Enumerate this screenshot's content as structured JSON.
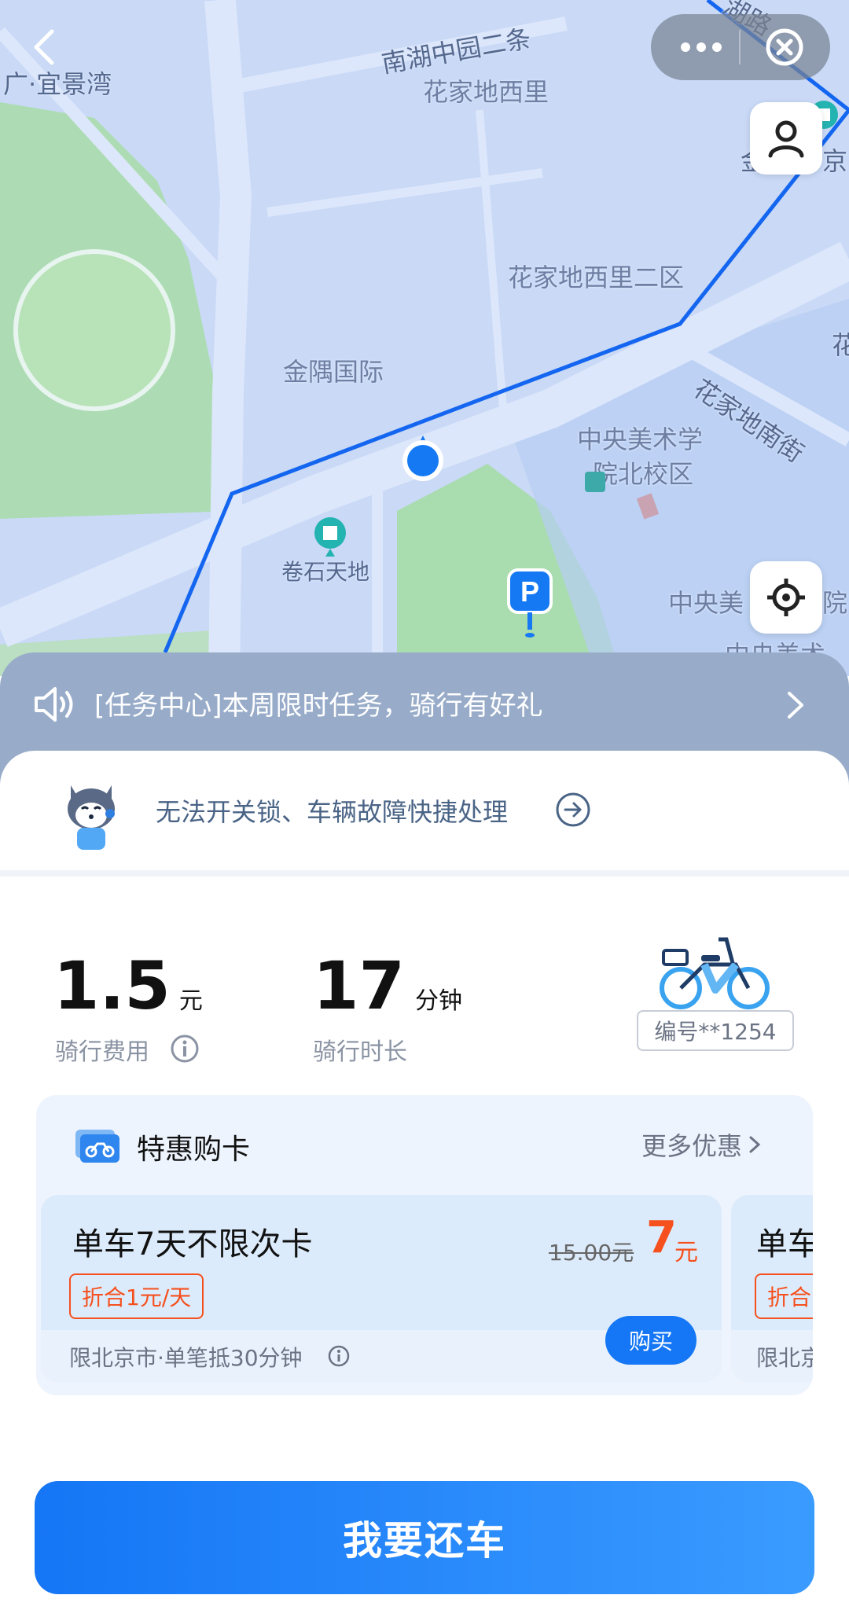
{
  "map": {
    "labels": [
      "广·宜景湾",
      "南湖中园二条",
      "花家地西里",
      "花家地西里二区",
      "金隅国际",
      "中央美术学",
      "院北校区",
      "花家地南街",
      "卷石天地",
      "中央美",
      "院",
      "金",
      "京",
      "花",
      "中央美术",
      "湖路"
    ]
  },
  "task_banner": {
    "text": "[任务中心]本周限时任务，骑行有好礼"
  },
  "support": {
    "text": "无法开关锁、车辆故障快捷处理"
  },
  "ride": {
    "fee_value": "1.5",
    "fee_unit": "元",
    "fee_label": "骑行费用",
    "duration_value": "17",
    "duration_unit": "分钟",
    "duration_label": "骑行时长",
    "bike_id": "编号**1254"
  },
  "deals": {
    "title": "特惠购卡",
    "more": "更多优惠",
    "cards": [
      {
        "name": "单车7天不限次卡",
        "orig_price": "15.00元",
        "price": "7",
        "price_unit": "元",
        "badge": "折合1元/天",
        "limit": "限北京市·单笔抵30分钟",
        "buy": "购买"
      },
      {
        "name": "单车",
        "badge": "折合",
        "limit": "限北京"
      }
    ]
  },
  "return_button": "我要还车",
  "colors": {
    "accent": "#1577f5",
    "price": "#f5501e",
    "map_bg": "#c8d8f6",
    "route": "#1466f0"
  }
}
